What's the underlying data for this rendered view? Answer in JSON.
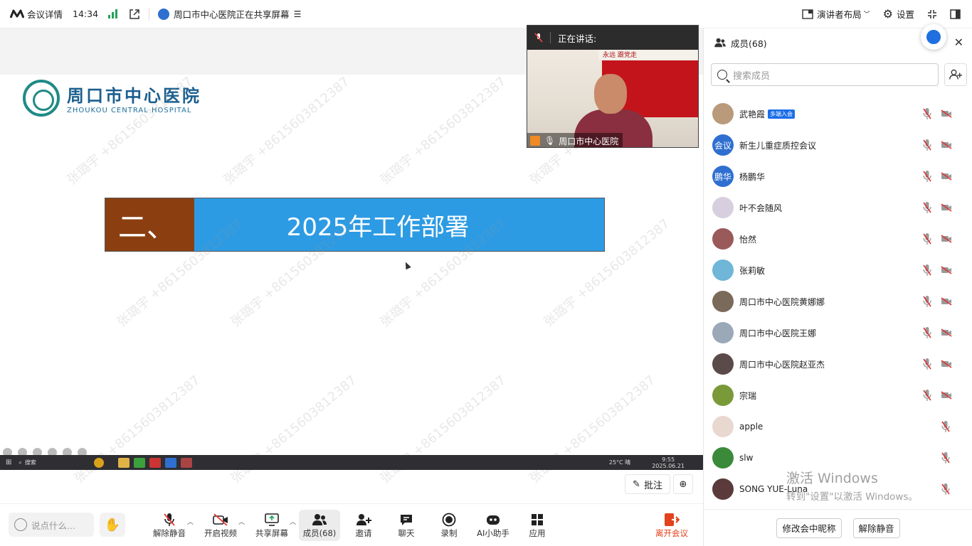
{
  "topbar": {
    "meeting_details": "会议详情",
    "time": "14:34",
    "sharing_status": "周口市中心医院正在共享屏幕",
    "layout": "演讲者布局",
    "settings": "设置"
  },
  "stage": {
    "logo_cn": "周口市中心医院",
    "logo_en": "ZHOUKOU CENTRAL HOSPITAL",
    "banner_num": "二、",
    "banner_title": "2025年工作部署",
    "watermark": "张璐宇 +8615603812387",
    "taskbar_search": "搜索",
    "taskbar_weather": "25°C 晴",
    "taskbar_time": "9:55",
    "taskbar_date": "2025.06.21",
    "annotate": "批注"
  },
  "video": {
    "speaking_label": "正在讲话:",
    "speaker_name": "周口市中心医院",
    "wall_text": "永远 跟党走"
  },
  "bottombar": {
    "say_placeholder": "说点什么...",
    "unmute": "解除静音",
    "start_video": "开启视频",
    "share_screen": "共享屏幕",
    "members": "成员(68)",
    "invite": "邀请",
    "chat": "聊天",
    "record": "录制",
    "ai": "AI小助手",
    "apps": "应用",
    "leave": "离开会议"
  },
  "panel": {
    "title": "成员(68)",
    "search_placeholder": "搜索成员",
    "members": [
      {
        "name": "武艳霞",
        "tag": "多端入会",
        "avatar_text": "",
        "avatar_color": "#b99a7a",
        "video": false
      },
      {
        "name": "新生儿重症质控会议",
        "tag": "",
        "avatar_text": "会议",
        "avatar_color": "#2f6fd0",
        "video": false
      },
      {
        "name": "杨鹏华",
        "tag": "",
        "avatar_text": "鹏华",
        "avatar_color": "#2f6fd0",
        "video": false
      },
      {
        "name": "叶不会随风",
        "tag": "",
        "avatar_text": "",
        "avatar_color": "#d7cfe0",
        "video": false
      },
      {
        "name": "怡然",
        "tag": "",
        "avatar_text": "",
        "avatar_color": "#9a5a5a",
        "video": false
      },
      {
        "name": "张莉敏",
        "tag": "",
        "avatar_text": "",
        "avatar_color": "#6fb6d8",
        "video": false
      },
      {
        "name": "周口市中心医院黄娜娜",
        "tag": "",
        "avatar_text": "",
        "avatar_color": "#7a6a5a",
        "video": false
      },
      {
        "name": "周口市中心医院王娜",
        "tag": "",
        "avatar_text": "",
        "avatar_color": "#9aa8b8",
        "video": false
      },
      {
        "name": "周口市中心医院赵亚杰",
        "tag": "",
        "avatar_text": "",
        "avatar_color": "#5a4a4a",
        "video": false
      },
      {
        "name": "宗瑞",
        "tag": "",
        "avatar_text": "",
        "avatar_color": "#7a9a3a",
        "video": false
      },
      {
        "name": "apple",
        "tag": "",
        "avatar_text": "",
        "avatar_color": "#e8d8d0",
        "video": null
      },
      {
        "name": "slw",
        "tag": "",
        "avatar_text": "",
        "avatar_color": "#3a8a3a",
        "video": null
      },
      {
        "name": "SONG YUE-Luna",
        "tag": "",
        "avatar_text": "",
        "avatar_color": "#5a3a3a",
        "video": null
      }
    ],
    "activate_title": "激活 Windows",
    "activate_sub": "转到\"设置\"以激活 Windows。",
    "rename": "修改会中昵称",
    "unmute_all": "解除静音"
  },
  "colors": {
    "accent": "#1a6ee8",
    "banner_brown": "#8b3f10",
    "banner_blue": "#2d9be3",
    "leave_red": "#e2421c",
    "mic_off_red": "#d33"
  }
}
